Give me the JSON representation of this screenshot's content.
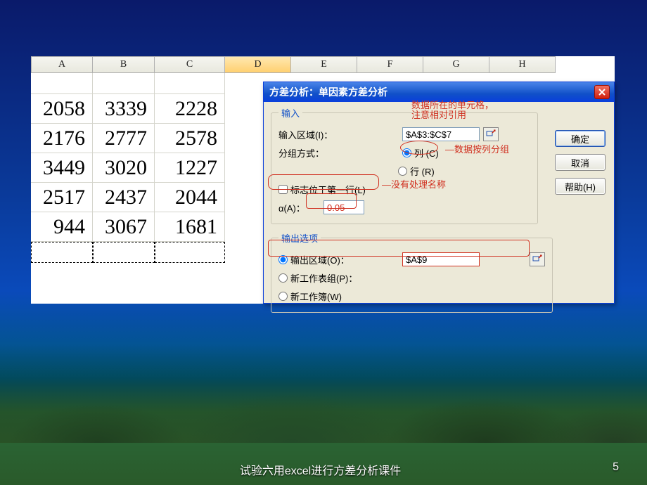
{
  "slide": {
    "footer_text": "试验六用excel进行方差分析课件",
    "page_number": "5"
  },
  "sheet": {
    "columns": [
      "A",
      "B",
      "C",
      "D",
      "E",
      "F",
      "G",
      "H"
    ],
    "selected_col": "D",
    "data": [
      [
        "2058",
        "3339",
        "2228"
      ],
      [
        "2176",
        "2777",
        "2578"
      ],
      [
        "3449",
        "3020",
        "1227"
      ],
      [
        "2517",
        "2437",
        "2044"
      ],
      [
        "944",
        "3067",
        "1681"
      ]
    ]
  },
  "dialog": {
    "title": "方差分析：单因素方差分析",
    "input_legend": "输入",
    "input_range_label": "输入区域(I)：",
    "input_range_value": "$A$3:$C$7",
    "group_label": "分组方式：",
    "radio_col": "列 (C)",
    "radio_row": "行 (R)",
    "first_row_label": "标志位于第一行(L)",
    "alpha_label": "α(A)：",
    "alpha_value": "0.05",
    "output_legend": "输出选项",
    "radio_output_range": "输出区域(O)：",
    "output_range_value": "$A$9",
    "radio_new_ws": "新工作表组(P)：",
    "radio_new_wb": "新工作簿(W)",
    "btn_ok": "确定",
    "btn_cancel": "取消",
    "btn_help": "帮助(H)"
  },
  "annotations": {
    "data_cells_note_1": "数据所在的单元格，",
    "data_cells_note_2": "注意相对引用",
    "group_by_col_note": "数据按列分组",
    "no_label_note": "没有处理名称"
  }
}
